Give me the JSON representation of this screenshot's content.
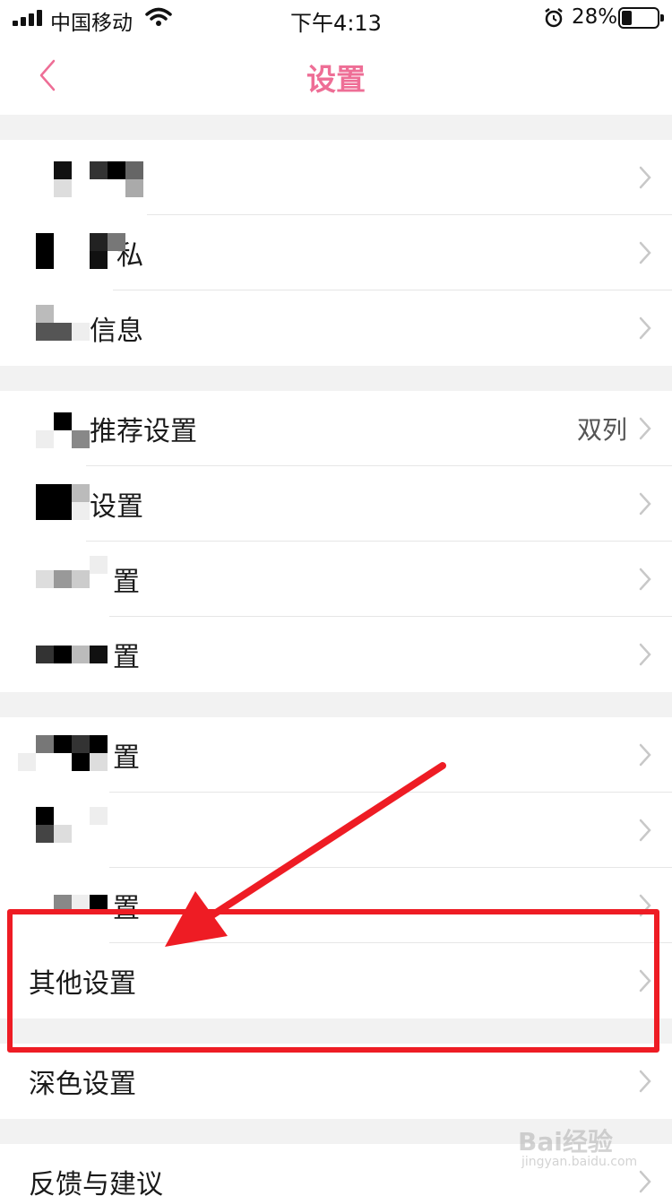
{
  "status_bar": {
    "carrier": "中国移动",
    "time": "下午4:13",
    "battery_percent": "28%",
    "battery_level": 0.28
  },
  "nav": {
    "title": "设置",
    "back_icon": "chevron-left-icon"
  },
  "sections": [
    {
      "items": [
        {
          "label": "账",
          "redacted": true
        },
        {
          "label": "私",
          "redacted": true
        },
        {
          "label": "信息",
          "redacted": true
        }
      ]
    },
    {
      "items": [
        {
          "label": "推荐设置",
          "value": "双列",
          "redacted": true
        },
        {
          "label": "设置",
          "redacted": true
        },
        {
          "label": "置",
          "redacted": true
        },
        {
          "label": "置",
          "redacted": true
        }
      ]
    },
    {
      "items": [
        {
          "label": "置",
          "redacted": true
        },
        {
          "label": "",
          "redacted": true
        },
        {
          "label": "置",
          "redacted": true
        },
        {
          "label": "其他设置",
          "redacted": false
        }
      ]
    },
    {
      "items": [
        {
          "label": "深色设置",
          "redacted": false
        }
      ]
    },
    {
      "items": [
        {
          "label": "反馈与建议",
          "redacted": false
        }
      ]
    }
  ],
  "annotation": {
    "highlight_color": "#ee1c24",
    "arrow_color": "#ee1c24"
  },
  "watermark": {
    "logo": "Bai经验",
    "site": "jingyan.baidu.com"
  },
  "colors": {
    "accent": "#ee6e96",
    "background_gap": "#f2f2f2"
  }
}
